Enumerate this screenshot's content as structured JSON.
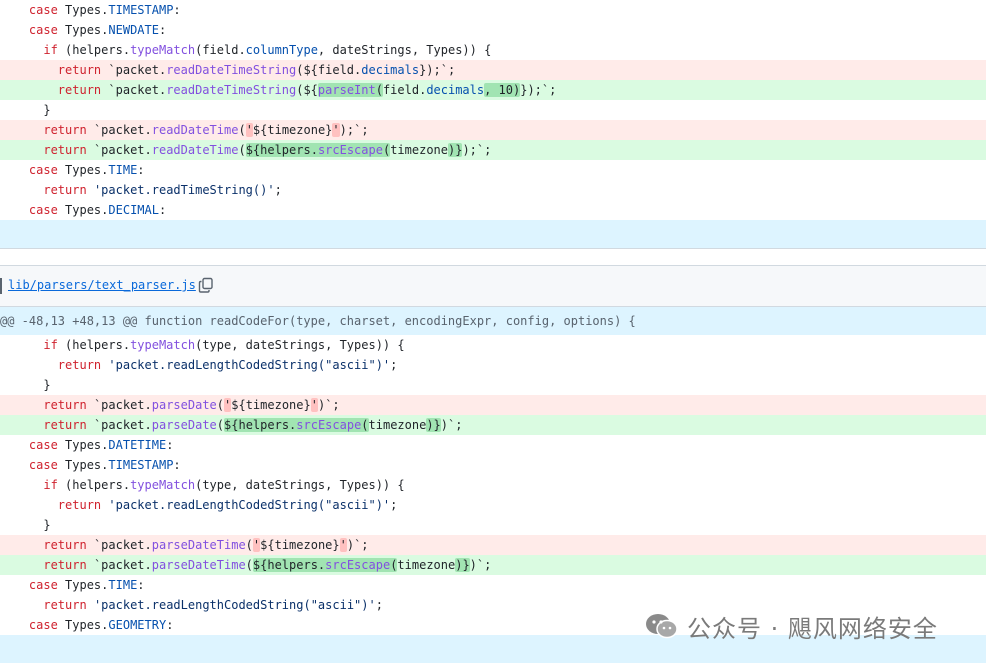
{
  "diff": {
    "file_name": "lib/parsers/text_parser.js",
    "hunk_header": "@@ -48,13 +48,13 @@ function readCodeFor(type, charset, encodingExpr, config, options) {"
  },
  "watermark": {
    "text": "公众号 · 飓风网络安全"
  },
  "icons": [
    "copy-icon",
    "wechat-icon"
  ]
}
